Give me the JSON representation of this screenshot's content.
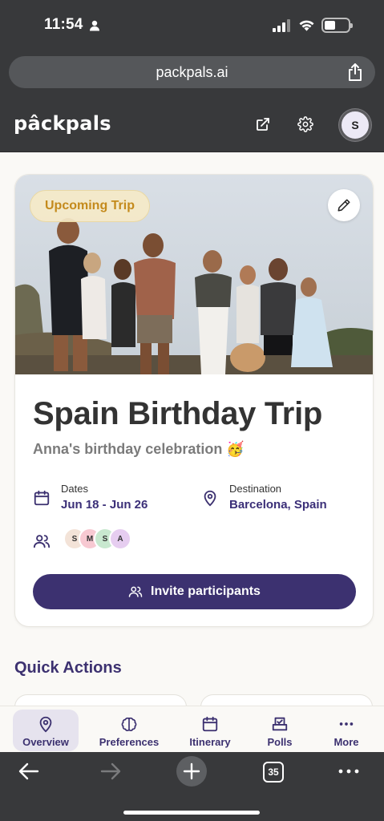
{
  "status_bar": {
    "time": "11:54"
  },
  "address_bar": {
    "url": "packpals.ai"
  },
  "app_header": {
    "logo": "pâckpals",
    "avatar_initial": "S"
  },
  "trip": {
    "badge": "Upcoming Trip",
    "title": "Spain Birthday Trip",
    "subtitle": "Anna's birthday celebration 🥳",
    "dates_label": "Dates",
    "dates_value": "Jun 18 - Jun 26",
    "destination_label": "Destination",
    "destination_value": "Barcelona, Spain",
    "participants": [
      {
        "initial": "S",
        "color": "#f3e3d8"
      },
      {
        "initial": "M",
        "color": "#f7c9d2"
      },
      {
        "initial": "S",
        "color": "#c8e8cf"
      },
      {
        "initial": "A",
        "color": "#e6cdf0"
      }
    ],
    "invite_label": "Invite participants"
  },
  "quick_actions": {
    "title": "Quick Actions"
  },
  "tabs": [
    {
      "label": "Overview",
      "icon": "map-pin-icon",
      "active": true
    },
    {
      "label": "Preferences",
      "icon": "brain-icon",
      "active": false
    },
    {
      "label": "Itinerary",
      "icon": "calendar-icon",
      "active": false
    },
    {
      "label": "Polls",
      "icon": "ballot-box-icon",
      "active": false
    },
    {
      "label": "More",
      "icon": "ellipsis-icon",
      "active": false
    }
  ],
  "browser_bar": {
    "tab_count": "35"
  },
  "colors": {
    "brand": "#3c3170",
    "badge_text": "#c48a1c",
    "chrome": "#38393b"
  }
}
